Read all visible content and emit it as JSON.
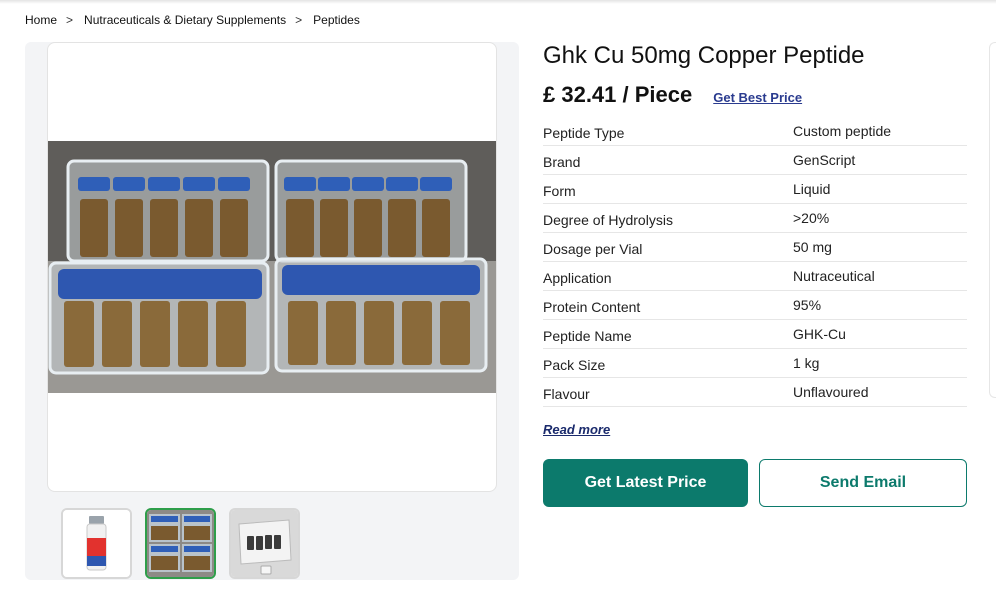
{
  "breadcrumb": {
    "items": [
      "Home",
      "Nutraceuticals & Dietary Supplements",
      "Peptides"
    ],
    "separator": ">"
  },
  "product": {
    "title": "Ghk Cu 50mg Copper Peptide",
    "price": "£ 32.41 / Piece",
    "best_price_link": "Get Best Price"
  },
  "specs": [
    {
      "label": "Peptide Type",
      "value": "Custom peptide"
    },
    {
      "label": "Brand",
      "value": "GenScript"
    },
    {
      "label": "Form",
      "value": "Liquid"
    },
    {
      "label": "Degree of Hydrolysis",
      "value": ">20%"
    },
    {
      "label": "Dosage per Vial",
      "value": "50 mg"
    },
    {
      "label": "Application",
      "value": "Nutraceutical"
    },
    {
      "label": "Protein Content",
      "value": "95%"
    },
    {
      "label": "Peptide Name",
      "value": "GHK-Cu"
    },
    {
      "label": "Pack Size",
      "value": "1 kg"
    },
    {
      "label": "Flavour",
      "value": "Unflavoured"
    }
  ],
  "read_more": "Read more",
  "buttons": {
    "latest_price": "Get Latest Price",
    "send_email": "Send Email"
  },
  "gallery": {
    "selected_index": 1,
    "thumbnails": [
      "vial-photo",
      "vial-boxes-photo",
      "vial-carton-photo"
    ]
  },
  "colors": {
    "primary": "#0c7a6c",
    "link": "#2a3b8f",
    "thumb_active": "#2e9e4a"
  }
}
